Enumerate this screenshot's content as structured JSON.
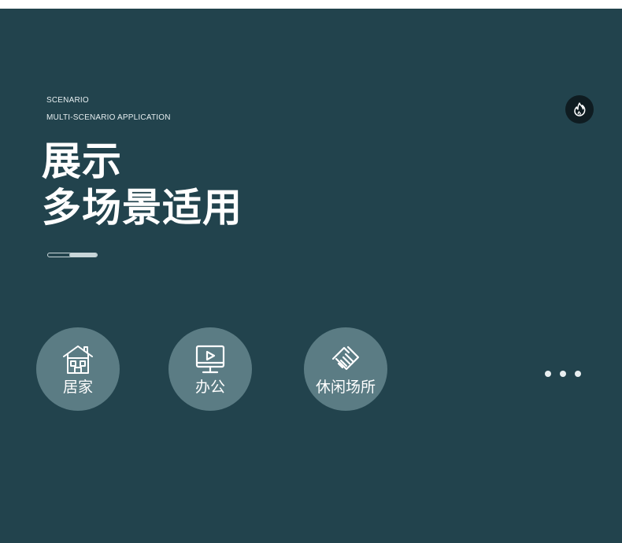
{
  "header": {
    "eyebrow_line1": "SCENARIO",
    "eyebrow_line2": "MULTI-SCENARIO APPLICATION",
    "title_line1": "展示",
    "title_line2": "多场景适用"
  },
  "scenes": [
    {
      "label": "居家",
      "icon": "house-icon"
    },
    {
      "label": "办公",
      "icon": "monitor-play-icon"
    },
    {
      "label": "休闲场所",
      "icon": "handshake-icon"
    }
  ],
  "colors": {
    "background": "#22434d",
    "circle": "#5b7c84",
    "text": "#ffffff",
    "badge": "#0f1c21"
  },
  "icons": {
    "badge": "flame-icon",
    "more": "more-dots-icon"
  }
}
